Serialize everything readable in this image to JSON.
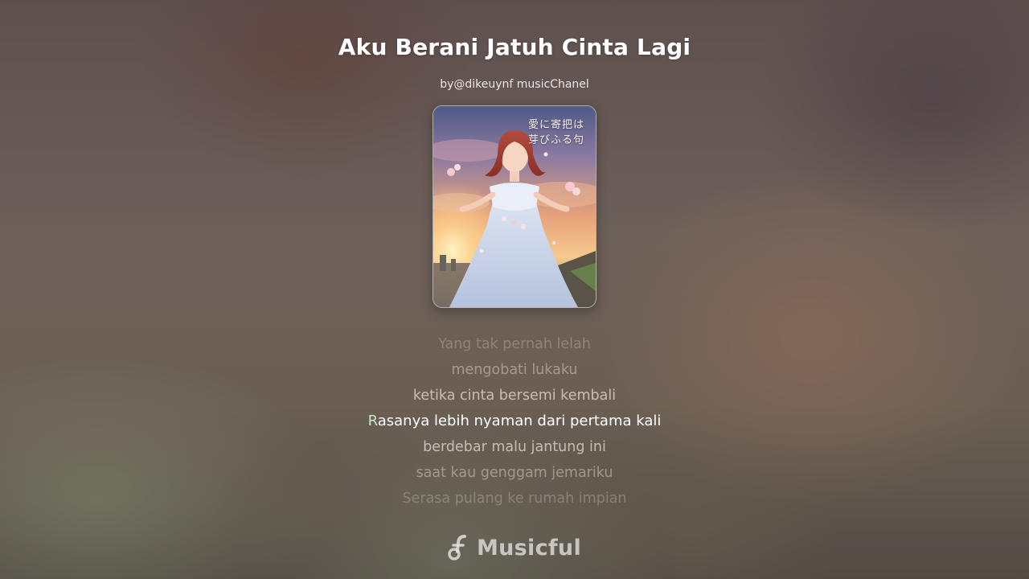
{
  "song": {
    "title": "Aku Berani Jatuh Cinta Lagi",
    "artist": "by@dikeuynf musicChanel"
  },
  "cover": {
    "caption": "愛に寄把は 芽びふる句"
  },
  "lyrics": {
    "lines": [
      {
        "text": "Yang tak pernah lelah",
        "state": "faded"
      },
      {
        "text": "mengobati lukaku",
        "state": "faded"
      },
      {
        "text": "ketika cinta bersemi kembali",
        "state": "near"
      },
      {
        "text": "Rasanya lebih nyaman dari pertama kali",
        "state": "active",
        "first_letter": "R",
        "rest": "asanya lebih nyaman dari pertama kali"
      },
      {
        "text": "berdebar malu jantung ini",
        "state": "near"
      },
      {
        "text": "saat kau genggam jemariku",
        "state": "faded"
      },
      {
        "text": "Serasa pulang ke rumah impian",
        "state": "faded"
      }
    ]
  },
  "brand": {
    "name": "Musicful",
    "icon": "music-note-icon"
  },
  "colors": {
    "title": "#ffffff",
    "active_lyric": "#ffffff",
    "active_lyric_first_letter": "#c4e7c3",
    "inactive_lyric": "#ebe1dc"
  }
}
